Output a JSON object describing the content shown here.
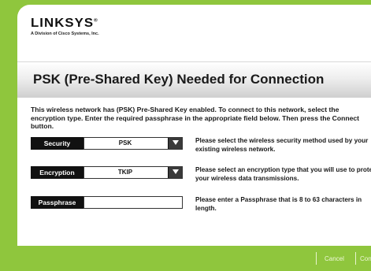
{
  "brand": {
    "logo_text": "LINKSYS",
    "logo_registered": "®",
    "tagline": "A Division of Cisco Systems, Inc."
  },
  "page": {
    "title": "PSK (Pre-Shared Key) Needed for Connection",
    "intro_part1": "This wireless network has (PSK) Pre-Shared Key enabled. To connect to this network, select the encryption type. Enter the required passphrase in the appropriate field below. Then press the ",
    "intro_bold": "Connect",
    "intro_part2": " button."
  },
  "form": {
    "security": {
      "label": "Security",
      "value": "PSK",
      "help": "Please select the wireless security method used by your existing wireless network."
    },
    "encryption": {
      "label": "Encryption",
      "value": "TKIP",
      "help": "Please select an encryption type that you will use to protect your wireless data transmissions."
    },
    "passphrase": {
      "label": "Passphrase",
      "value": "",
      "help": "Please enter a Passphrase that is 8 to 63 characters in length."
    }
  },
  "buttons": {
    "cancel": "Cancel",
    "connect": "Conn"
  },
  "colors": {
    "accent_green": "#8fc63d",
    "label_bg": "#111111"
  }
}
